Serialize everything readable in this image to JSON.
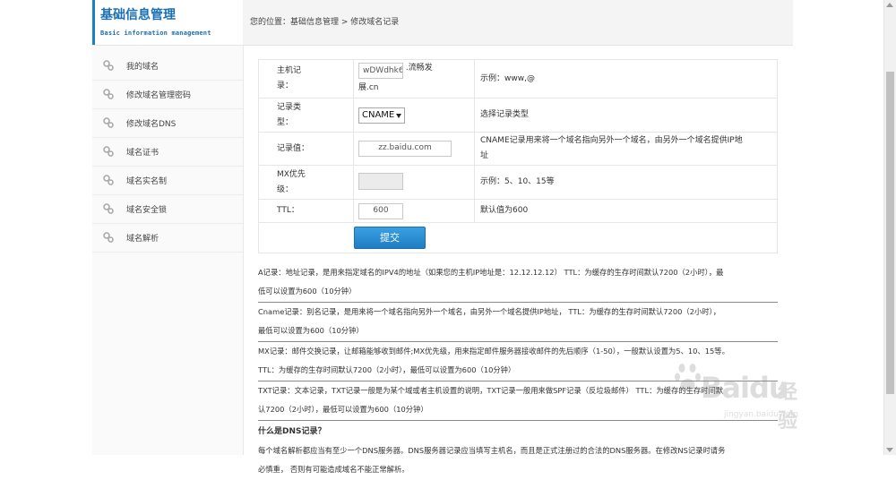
{
  "brand": {
    "title": "基础信息管理",
    "subtitle": "Basic information management"
  },
  "breadcrumb": "您的位置：基础信息管理 > 修改域名记录",
  "sidebar": {
    "items": [
      {
        "label": "我的域名"
      },
      {
        "label": "修改域名管理密码"
      },
      {
        "label": "修改域名DNS"
      },
      {
        "label": "域名证书"
      },
      {
        "label": "域名实名制"
      },
      {
        "label": "域名安全锁"
      },
      {
        "label": "域名解析"
      }
    ]
  },
  "form": {
    "host": {
      "label_line1": "主机记",
      "label_line2": "录：",
      "value": "wDWdhk6t",
      "suffix_line1": ".流畅发",
      "suffix_line2": "展.cn",
      "hint": "示例：www,@"
    },
    "type": {
      "label_line1": "记录类",
      "label_line2": "型：",
      "value": "CNAME",
      "hint": "选择记录类型"
    },
    "record": {
      "label": "记录值：",
      "value": "zz.baidu.com",
      "hint_line1": "CNAME记录用来将一个域名指向另外一个域名，由另外一个域名提供IP地",
      "hint_line2": "址"
    },
    "mx": {
      "label_line1": "MX优先",
      "label_line2": "级：",
      "value": "",
      "hint": "示例：5、10、15等"
    },
    "ttl": {
      "label": "TTL：",
      "value": "600",
      "hint": "默认值为600"
    },
    "submit_label": "提交"
  },
  "help": {
    "a_record_1": "A记录：地址记录，是用来指定域名的IPV4的地址（如果您的主机IP地址是：12.12.12.12） TTL：为缓存的生存时间默认7200（2小时），最",
    "a_record_2": "低可以设置为600（10分钟）",
    "cname_1": "Cname记录：别名记录，是用来将一个域名指向另外一个域名，由另外一个域名提供IP地址， TTL：为缓存的生存时间默认7200（2小时），",
    "cname_2": "最低可以设置为600（10分钟）",
    "mx_1": "MX记录：邮件交换记录，让邮箱能够收到邮件;MX优先级，用来指定邮件服务器接收邮件的先后顺序（1-50），一般默认设置为5、10、15等。",
    "mx_2": "TTL：为缓存的生存时间默认7200（2小时），最低可以设置为600（10分钟）",
    "txt_1": "TXT记录：文本记录，TXT记录一般是为某个域或者主机设置的说明，TXT记录一般用来做SPF记录（反垃圾邮件） TTL：为缓存的生存时间默",
    "txt_2": "认7200（2小时），最低可以设置为600（10分钟）",
    "dns_heading": "什么是DNS记录？",
    "dns_1": "每个域名解析都应当有至少一个DNS服务器。DNS服务器记录应当填写主机名，而且是正式注册过的合法的DNS服务器。在修改NS记录时请务",
    "dns_2": "必慎重，  否则有可能造成域名不能正常解析。"
  },
  "watermark": {
    "text": "Baidu",
    "cn": "经验",
    "url": "jingyan.baidu.com"
  },
  "colors": {
    "accent": "#1a7fc4",
    "button": "#2a8fd4"
  }
}
